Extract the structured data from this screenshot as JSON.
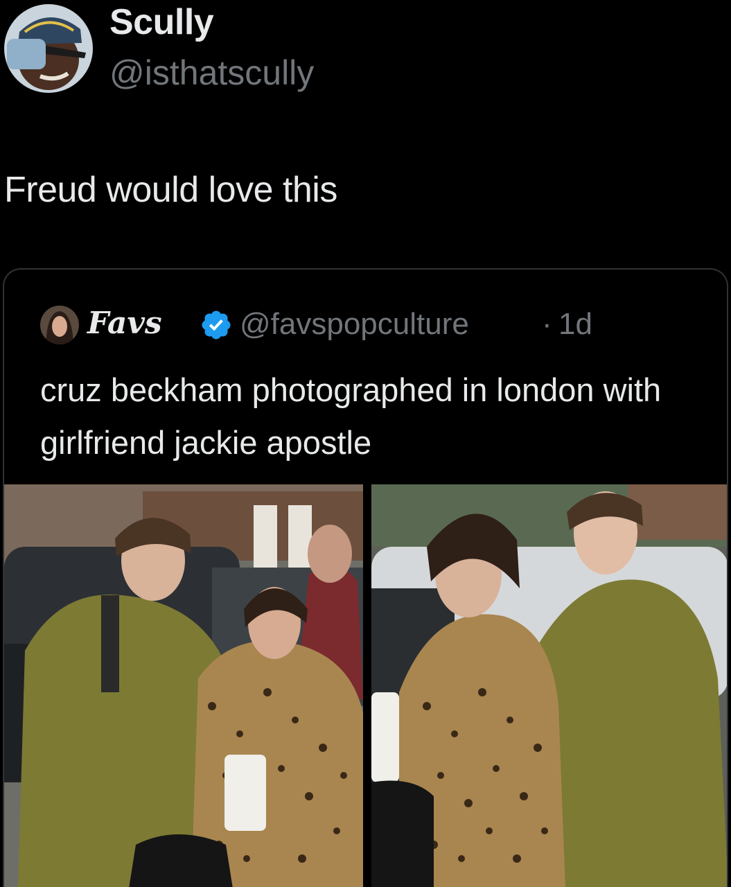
{
  "tweet": {
    "author_name": "Scully",
    "author_handle": "@isthatscully",
    "text": "Freud would love this"
  },
  "quoted_tweet": {
    "author_name": "Favs",
    "verified": true,
    "author_handle": "@favspopculture",
    "separator": "·",
    "time": "1d",
    "text": "cruz beckham photographed in london with girlfriend jackie apostle",
    "photos": [
      {
        "description_icon": "photo-cruz-and-jackie-walking-icon"
      },
      {
        "description_icon": "photo-jackie-and-cruz-closeup-icon"
      }
    ]
  },
  "colors": {
    "background": "#000000",
    "primary_text": "#e7e9ea",
    "secondary_text": "#71767b",
    "card_border": "#2f3336",
    "verified_blue": "#1d9bf0"
  }
}
